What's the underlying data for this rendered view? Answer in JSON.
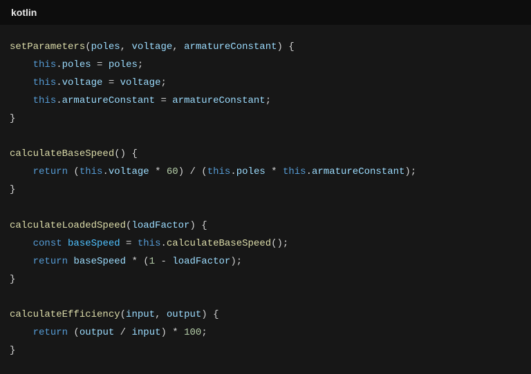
{
  "header": {
    "language": "kotlin"
  },
  "tokens": {
    "fnSetParameters": "setParameters",
    "pPoles": "poles",
    "pVoltage": "voltage",
    "pArmature": "armatureConstant",
    "this": "this",
    "propPoles": "poles",
    "propVoltage": "voltage",
    "propArmature": "armatureConstant",
    "fnCalcBase": "calculateBaseSpeed",
    "kwReturn": "return",
    "num60": "60",
    "fnCalcLoaded": "calculateLoadedSpeed",
    "pLoadFactor": "loadFactor",
    "kwConst": "const",
    "varBaseSpeed": "baseSpeed",
    "num1": "1",
    "fnCalcEff": "calculateEfficiency",
    "pInput": "input",
    "pOutput": "output",
    "num100": "100"
  }
}
